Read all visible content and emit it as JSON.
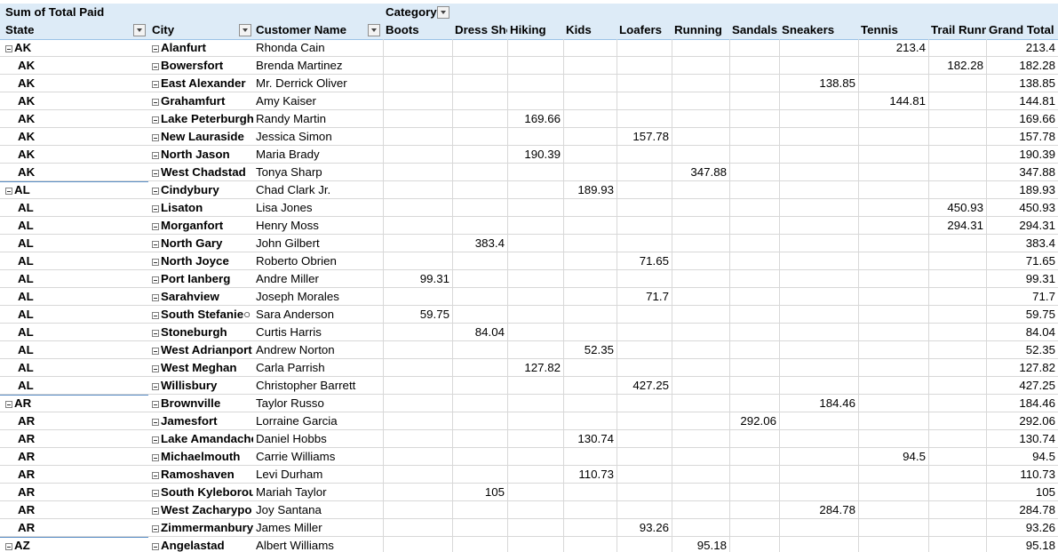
{
  "header": {
    "title": "Sum of Total Paid",
    "col_label": "Category",
    "state_label": "State",
    "city_label": "City",
    "customer_label": "Customer Name",
    "categories": [
      "Boots",
      "Dress Shoes",
      "Hiking",
      "Kids",
      "Loafers",
      "Running",
      "Sandals",
      "Sneakers",
      "Tennis",
      "Trail Running",
      "Grand Total"
    ]
  },
  "rows": [
    {
      "state": "AK",
      "city": "Alanfurt",
      "customer": "Rhonda Cain",
      "values": [
        "",
        "",
        "",
        "",
        "",
        "",
        "",
        "",
        "213.4",
        "",
        "213.4"
      ]
    },
    {
      "state": "AK",
      "city": "Bowersfort",
      "customer": "Brenda Martinez",
      "values": [
        "",
        "",
        "",
        "",
        "",
        "",
        "",
        "",
        "",
        "182.28",
        "182.28"
      ]
    },
    {
      "state": "AK",
      "city": "East Alexander",
      "customer": "Mr. Derrick Oliver",
      "values": [
        "",
        "",
        "",
        "",
        "",
        "",
        "",
        "138.85",
        "",
        "",
        "138.85"
      ]
    },
    {
      "state": "AK",
      "city": "Grahamfurt",
      "customer": "Amy Kaiser",
      "values": [
        "",
        "",
        "",
        "",
        "",
        "",
        "",
        "",
        "144.81",
        "",
        "144.81"
      ]
    },
    {
      "state": "AK",
      "city": "Lake Peterburgh",
      "customer": "Randy Martin",
      "values": [
        "",
        "",
        "169.66",
        "",
        "",
        "",
        "",
        "",
        "",
        "",
        "169.66"
      ]
    },
    {
      "state": "AK",
      "city": "New Lauraside",
      "customer": "Jessica Simon",
      "values": [
        "",
        "",
        "",
        "",
        "157.78",
        "",
        "",
        "",
        "",
        "",
        "157.78"
      ]
    },
    {
      "state": "AK",
      "city": "North Jason",
      "customer": "Maria Brady",
      "values": [
        "",
        "",
        "190.39",
        "",
        "",
        "",
        "",
        "",
        "",
        "",
        "190.39"
      ]
    },
    {
      "state": "AK",
      "city": "West Chadstad",
      "customer": "Tonya Sharp",
      "values": [
        "",
        "",
        "",
        "",
        "",
        "347.88",
        "",
        "",
        "",
        "",
        "347.88"
      ]
    },
    {
      "state": "AL",
      "city": "Cindybury",
      "customer": "Chad Clark Jr.",
      "values": [
        "",
        "",
        "",
        "189.93",
        "",
        "",
        "",
        "",
        "",
        "",
        "189.93"
      ]
    },
    {
      "state": "AL",
      "city": "Lisaton",
      "customer": "Lisa Jones",
      "values": [
        "",
        "",
        "",
        "",
        "",
        "",
        "",
        "",
        "",
        "450.93",
        "450.93"
      ]
    },
    {
      "state": "AL",
      "city": "Morganfort",
      "customer": "Henry Moss",
      "values": [
        "",
        "",
        "",
        "",
        "",
        "",
        "",
        "",
        "",
        "294.31",
        "294.31"
      ]
    },
    {
      "state": "AL",
      "city": "North Gary",
      "customer": "John Gilbert",
      "values": [
        "",
        "383.4",
        "",
        "",
        "",
        "",
        "",
        "",
        "",
        "",
        "383.4"
      ]
    },
    {
      "state": "AL",
      "city": "North Joyce",
      "customer": "Roberto Obrien",
      "values": [
        "",
        "",
        "",
        "",
        "71.65",
        "",
        "",
        "",
        "",
        "",
        "71.65"
      ]
    },
    {
      "state": "AL",
      "city": "Port Ianberg",
      "customer": "Andre Miller",
      "values": [
        "99.31",
        "",
        "",
        "",
        "",
        "",
        "",
        "",
        "",
        "",
        "99.31"
      ]
    },
    {
      "state": "AL",
      "city": "Sarahview",
      "customer": "Joseph Morales",
      "values": [
        "",
        "",
        "",
        "",
        "71.7",
        "",
        "",
        "",
        "",
        "",
        "71.7"
      ]
    },
    {
      "state": "AL",
      "city": "South Stefanie○",
      "customer": "Sara Anderson",
      "values": [
        "59.75",
        "",
        "",
        "",
        "",
        "",
        "",
        "",
        "",
        "",
        "59.75"
      ]
    },
    {
      "state": "AL",
      "city": "Stoneburgh",
      "customer": "Curtis Harris",
      "values": [
        "",
        "84.04",
        "",
        "",
        "",
        "",
        "",
        "",
        "",
        "",
        "84.04"
      ]
    },
    {
      "state": "AL",
      "city": "West Adrianport",
      "customer": "Andrew Norton",
      "values": [
        "",
        "",
        "",
        "52.35",
        "",
        "",
        "",
        "",
        "",
        "",
        "52.35"
      ]
    },
    {
      "state": "AL",
      "city": "West Meghan",
      "customer": "Carla Parrish",
      "values": [
        "",
        "",
        "127.82",
        "",
        "",
        "",
        "",
        "",
        "",
        "",
        "127.82"
      ]
    },
    {
      "state": "AL",
      "city": "Willisbury",
      "customer": "Christopher Barrett",
      "values": [
        "",
        "",
        "",
        "",
        "427.25",
        "",
        "",
        "",
        "",
        "",
        "427.25"
      ]
    },
    {
      "state": "AR",
      "city": "Brownville",
      "customer": "Taylor Russo",
      "values": [
        "",
        "",
        "",
        "",
        "",
        "",
        "",
        "184.46",
        "",
        "",
        "184.46"
      ]
    },
    {
      "state": "AR",
      "city": "Jamesfort",
      "customer": "Lorraine Garcia",
      "values": [
        "",
        "",
        "",
        "",
        "",
        "",
        "292.06",
        "",
        "",
        "",
        "292.06"
      ]
    },
    {
      "state": "AR",
      "city": "Lake Amandache",
      "customer": "Daniel Hobbs",
      "values": [
        "",
        "",
        "",
        "130.74",
        "",
        "",
        "",
        "",
        "",
        "",
        "130.74"
      ]
    },
    {
      "state": "AR",
      "city": "Michaelmouth",
      "customer": "Carrie Williams",
      "values": [
        "",
        "",
        "",
        "",
        "",
        "",
        "",
        "",
        "94.5",
        "",
        "94.5"
      ]
    },
    {
      "state": "AR",
      "city": "Ramoshaven",
      "customer": "Levi Durham",
      "values": [
        "",
        "",
        "",
        "110.73",
        "",
        "",
        "",
        "",
        "",
        "",
        "110.73"
      ]
    },
    {
      "state": "AR",
      "city": "South Kyleborou",
      "customer": "Mariah Taylor",
      "values": [
        "",
        "105",
        "",
        "",
        "",
        "",
        "",
        "",
        "",
        "",
        "105"
      ]
    },
    {
      "state": "AR",
      "city": "West Zacharypo",
      "customer": "Joy Santana",
      "values": [
        "",
        "",
        "",
        "",
        "",
        "",
        "",
        "284.78",
        "",
        "",
        "284.78"
      ]
    },
    {
      "state": "AR",
      "city": "Zimmermanbury",
      "customer": "James Miller",
      "values": [
        "",
        "",
        "",
        "",
        "93.26",
        "",
        "",
        "",
        "",
        "",
        "93.26"
      ]
    },
    {
      "state": "AZ",
      "city": "Angelastad",
      "customer": "Albert Williams",
      "values": [
        "",
        "",
        "",
        "",
        "",
        "95.18",
        "",
        "",
        "",
        "",
        "95.18"
      ]
    }
  ]
}
